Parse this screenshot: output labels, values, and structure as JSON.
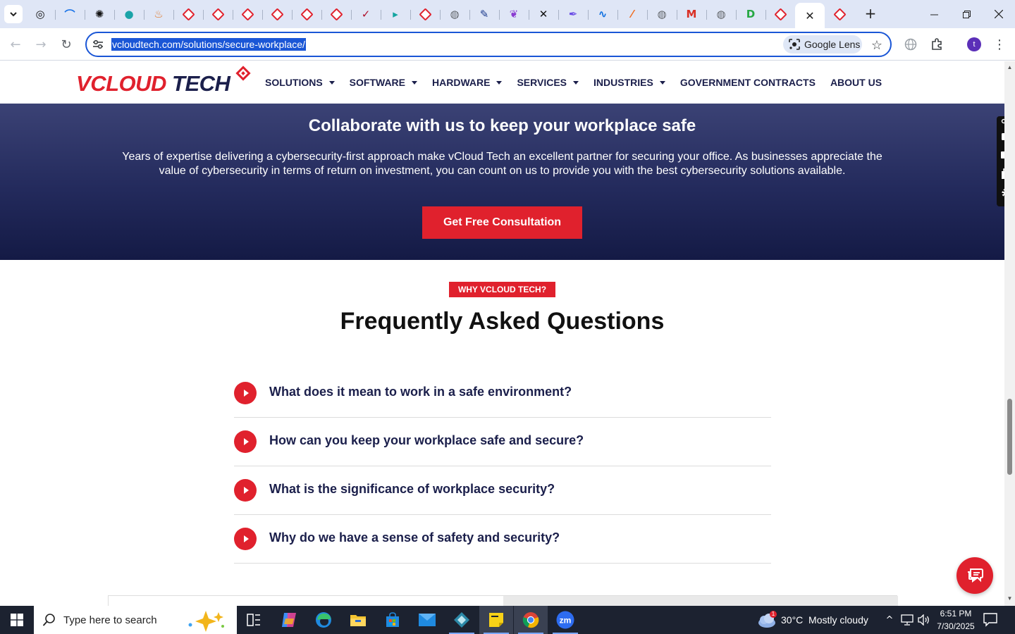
{
  "browser": {
    "tabs": [
      {
        "icon": "chatgpt-icon",
        "color": "#111111",
        "glyph": "◎"
      },
      {
        "icon": "wifi-arc-icon",
        "color": "#1a73e8",
        "glyph": "⌒"
      },
      {
        "icon": "openai-icon",
        "color": "#111111",
        "glyph": "✺"
      },
      {
        "icon": "teal-circle-icon",
        "color": "#1aa3a8",
        "glyph": "●"
      },
      {
        "icon": "flame-icon",
        "color": "#e07a2d",
        "glyph": "♨"
      },
      {
        "icon": "vcloud-favicon",
        "color": "#e0212d",
        "glyph": ""
      },
      {
        "icon": "vcloud-favicon",
        "color": "#e0212d",
        "glyph": ""
      },
      {
        "icon": "vcloud-favicon",
        "color": "#e0212d",
        "glyph": ""
      },
      {
        "icon": "vcloud-favicon",
        "color": "#e0212d",
        "glyph": ""
      },
      {
        "icon": "vcloud-favicon",
        "color": "#e0212d",
        "glyph": ""
      },
      {
        "icon": "vcloud-favicon",
        "color": "#e0212d",
        "glyph": ""
      },
      {
        "icon": "check-v-icon",
        "color": "#b0122c",
        "glyph": "✓"
      },
      {
        "icon": "teal-arrow-icon",
        "color": "#12a4a0",
        "glyph": "▸"
      },
      {
        "icon": "vcloud-favicon",
        "color": "#e0212d",
        "glyph": ""
      },
      {
        "icon": "globe-icon",
        "color": "#5f6368",
        "glyph": "◍"
      },
      {
        "icon": "feather-icon",
        "color": "#1b3a8c",
        "glyph": "✎"
      },
      {
        "icon": "purple-leaf-icon",
        "color": "#8a3bd1",
        "glyph": "❦"
      },
      {
        "icon": "x-logo-icon",
        "color": "#111111",
        "glyph": "✕"
      },
      {
        "icon": "pen-icon",
        "color": "#6b4de6",
        "glyph": "✒"
      },
      {
        "icon": "pulse-icon",
        "color": "#0b6ee0",
        "glyph": "∿"
      },
      {
        "icon": "slash-icon",
        "color": "#f06a1d",
        "glyph": "⁄"
      },
      {
        "icon": "globe-icon",
        "color": "#5f6368",
        "glyph": "◍"
      },
      {
        "icon": "gmail-icon",
        "color": "#d93025",
        "glyph": "M"
      },
      {
        "icon": "globe-icon",
        "color": "#5f6368",
        "glyph": "◍"
      },
      {
        "icon": "d-logo-icon",
        "color": "#27a844",
        "glyph": "D"
      },
      {
        "icon": "vcloud-favicon",
        "color": "#e0212d",
        "glyph": ""
      },
      {
        "icon": "close-icon",
        "color": "#222222",
        "glyph": "✕",
        "active": true
      },
      {
        "icon": "vcloud-favicon",
        "color": "#e0212d",
        "glyph": ""
      }
    ],
    "new_tab": "+",
    "url": "vcloudtech.com/solutions/secure-workplace/",
    "lens_label": "Google Lens",
    "profile_initial": "t"
  },
  "site": {
    "logo": {
      "v": "V",
      "cloud": "CLOUD",
      "tech": " TECH"
    },
    "nav": [
      {
        "label": "SOLUTIONS",
        "dropdown": true
      },
      {
        "label": "SOFTWARE",
        "dropdown": true
      },
      {
        "label": "HARDWARE",
        "dropdown": true
      },
      {
        "label": "SERVICES",
        "dropdown": true
      },
      {
        "label": "INDUSTRIES",
        "dropdown": true
      },
      {
        "label": "GOVERNMENT CONTRACTS",
        "dropdown": false
      },
      {
        "label": "ABOUT US",
        "dropdown": false
      }
    ],
    "hero": {
      "title": "Collaborate with us to keep your workplace safe",
      "body": "Years of expertise delivering a cybersecurity-first approach make vCloud Tech an excellent partner for securing your office. As businesses appreciate the value of cybersecurity in terms of return on investment, you can count on us to provide you with the best cybersecurity solutions available.",
      "cta": "Get Free Consultation"
    },
    "faq": {
      "badge": "WHY VCLOUD TECH?",
      "title": "Frequently Asked Questions",
      "items": [
        "What does it mean to work in a safe environment?",
        "How can you keep your workplace safe and secure?",
        "What is the significance of workplace security?",
        "Why do we have a sense of safety and security?"
      ]
    },
    "colors": {
      "brand_red": "#e0212d",
      "navy": "#1b1f4b"
    }
  },
  "taskbar": {
    "search_placeholder": "Type here to search",
    "weather_badge": "1",
    "weather": "30°C  Mostly cloudy",
    "time": "6:51 PM",
    "date": "7/30/2025"
  }
}
